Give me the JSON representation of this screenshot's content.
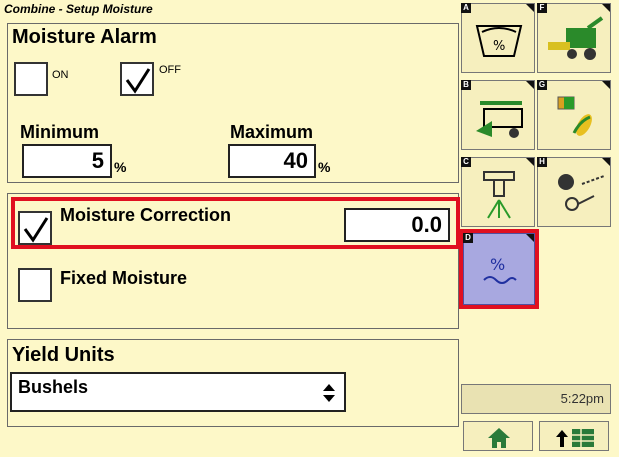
{
  "window_title": "Combine - Setup Moisture",
  "moisture_alarm": {
    "title": "Moisture Alarm",
    "on_label": "ON",
    "off_label": "OFF",
    "on_checked": false,
    "off_checked": true,
    "minimum_label": "Minimum",
    "maximum_label": "Maximum",
    "minimum_value": "5",
    "maximum_value": "40",
    "unit": "%"
  },
  "moisture_correction": {
    "label": "Moisture Correction",
    "checked": true,
    "value": "0.0"
  },
  "fixed_moisture": {
    "label": "Fixed Moisture",
    "checked": false
  },
  "yield_units": {
    "title": "Yield Units",
    "selected": "Bushels"
  },
  "tiles": [
    {
      "letter": "A",
      "icon": "moisture-percent-bin-icon"
    },
    {
      "letter": "F",
      "icon": "combine-harvester-icon"
    },
    {
      "letter": "B",
      "icon": "combine-header-icon"
    },
    {
      "letter": "G",
      "icon": "crop-corn-icon"
    },
    {
      "letter": "C",
      "icon": "sprayer-nozzle-icon"
    },
    {
      "letter": "H",
      "icon": "grain-loss-monitor-icon"
    },
    {
      "letter": "D",
      "icon": "moisture-percent-water-icon"
    }
  ],
  "clock": "5:22pm",
  "softkeys": {
    "home_icon": "home-icon",
    "menu_icon": "up-arrow-menu-icon"
  },
  "colors": {
    "background": "#fdf8c8",
    "highlight": "#e01020",
    "selected_tile": "#a8a8e0"
  }
}
